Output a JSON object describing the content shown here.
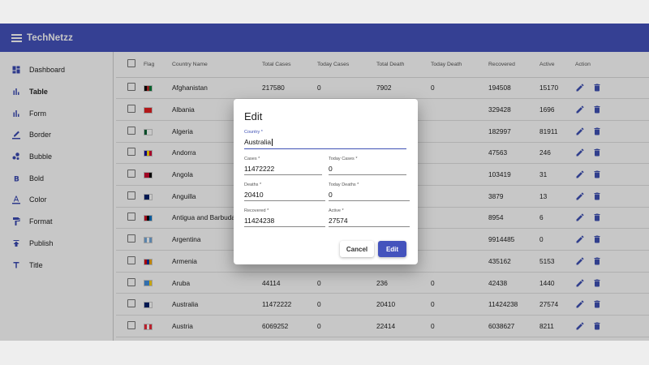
{
  "app": {
    "title": "TechNetzz"
  },
  "colors": {
    "primary": "#4453bd",
    "action_icon": "#3f51b5"
  },
  "sidebar": {
    "items": [
      {
        "label": "Dashboard",
        "icon": "dashboard-icon"
      },
      {
        "label": "Table",
        "icon": "bar-chart-icon",
        "active": true
      },
      {
        "label": "Form",
        "icon": "bar-chart-icon"
      },
      {
        "label": "Border",
        "icon": "border-color-icon"
      },
      {
        "label": "Bubble",
        "icon": "bubble-chart-icon"
      },
      {
        "label": "Bold",
        "icon": "format-bold-icon"
      },
      {
        "label": "Color",
        "icon": "text-color-icon"
      },
      {
        "label": "Format",
        "icon": "format-paint-icon"
      },
      {
        "label": "Publish",
        "icon": "publish-icon"
      },
      {
        "label": "Title",
        "icon": "title-icon"
      }
    ]
  },
  "table": {
    "headers": {
      "flag": "Flag",
      "country": "Country Name",
      "total_cases": "Total Cases",
      "today_cases": "Today Cases",
      "total_death": "Total Death",
      "today_death": "Today Death",
      "recovered": "Recovered",
      "active": "Active",
      "action": "Action"
    },
    "rows": [
      {
        "country": "Afghanistan",
        "total_cases": "217580",
        "today_cases": "0",
        "total_death": "7902",
        "today_death": "0",
        "recovered": "194508",
        "active": "15170",
        "flag": [
          "#000000",
          "#b92a2a",
          "#007a36"
        ]
      },
      {
        "country": "Albania",
        "total_cases": "",
        "today_cases": "",
        "total_death": "",
        "today_death": "",
        "recovered": "329428",
        "active": "1696",
        "flag": [
          "#e41e20",
          "#e41e20",
          "#e41e20"
        ]
      },
      {
        "country": "Algeria",
        "total_cases": "",
        "today_cases": "",
        "total_death": "",
        "today_death": "",
        "recovered": "182997",
        "active": "81911",
        "flag": [
          "#006233",
          "#ffffff",
          "#ffffff"
        ]
      },
      {
        "country": "Andorra",
        "total_cases": "",
        "today_cases": "",
        "total_death": "",
        "today_death": "",
        "recovered": "47563",
        "active": "246",
        "flag": [
          "#10069f",
          "#fedd00",
          "#d50032"
        ]
      },
      {
        "country": "Angola",
        "total_cases": "",
        "today_cases": "",
        "total_death": "",
        "today_death": "",
        "recovered": "103419",
        "active": "31",
        "flag": [
          "#cc092f",
          "#cc092f",
          "#000000"
        ]
      },
      {
        "country": "Anguilla",
        "total_cases": "",
        "today_cases": "",
        "total_death": "",
        "today_death": "",
        "recovered": "3879",
        "active": "13",
        "flag": [
          "#012169",
          "#012169",
          "#ffffff"
        ]
      },
      {
        "country": "Antigua and Barbuda",
        "total_cases": "",
        "today_cases": "",
        "total_death": "",
        "today_death": "",
        "recovered": "8954",
        "active": "6",
        "flag": [
          "#ce1126",
          "#000000",
          "#0072c6"
        ]
      },
      {
        "country": "Argentina",
        "total_cases": "",
        "today_cases": "",
        "total_death": "",
        "today_death": "",
        "recovered": "9914485",
        "active": "0",
        "flag": [
          "#75aadb",
          "#ffffff",
          "#75aadb"
        ]
      },
      {
        "country": "Armenia",
        "total_cases": "",
        "today_cases": "",
        "total_death": "",
        "today_death": "",
        "recovered": "435162",
        "active": "5153",
        "flag": [
          "#d90012",
          "#0033a0",
          "#f2a800"
        ]
      },
      {
        "country": "Aruba",
        "total_cases": "44114",
        "today_cases": "0",
        "total_death": "236",
        "today_death": "0",
        "recovered": "42438",
        "active": "1440",
        "flag": [
          "#418fde",
          "#418fde",
          "#fcd116"
        ]
      },
      {
        "country": "Australia",
        "total_cases": "11472222",
        "today_cases": "0",
        "total_death": "20410",
        "today_death": "0",
        "recovered": "11424238",
        "active": "27574",
        "flag": [
          "#012169",
          "#012169",
          "#ffffff"
        ]
      },
      {
        "country": "Austria",
        "total_cases": "6069252",
        "today_cases": "0",
        "total_death": "22414",
        "today_death": "0",
        "recovered": "6038627",
        "active": "8211",
        "flag": [
          "#ed2939",
          "#ffffff",
          "#ed2939"
        ]
      }
    ]
  },
  "dialog": {
    "title": "Edit",
    "fields": {
      "country": {
        "label": "Country *",
        "value": "Australia"
      },
      "cases": {
        "label": "Cases *",
        "value": "11472222"
      },
      "today_cases": {
        "label": "Today Cases *",
        "value": "0"
      },
      "deaths": {
        "label": "Deaths *",
        "value": "20410"
      },
      "today_deaths": {
        "label": "Today Deaths *",
        "value": "0"
      },
      "recovered": {
        "label": "Recovered *",
        "value": "11424238"
      },
      "active": {
        "label": "Active *",
        "value": "27574"
      }
    },
    "cancel_label": "Cancel",
    "edit_label": "Edit"
  }
}
